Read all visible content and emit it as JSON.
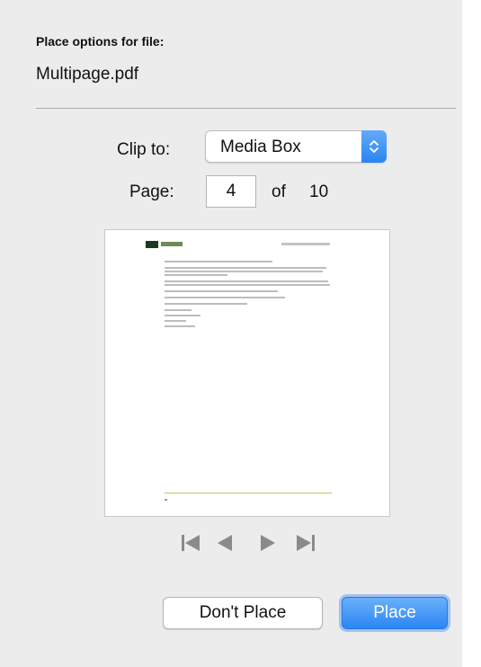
{
  "dialog": {
    "heading": "Place options for file:",
    "filename": "Multipage.pdf"
  },
  "clip": {
    "label": "Clip to:",
    "value": "Media Box"
  },
  "page": {
    "label": "Page:",
    "current": "4",
    "of_label": "of",
    "total": "10"
  },
  "navigation": {
    "first_icon": "first-page-icon",
    "prev_icon": "previous-page-icon",
    "next_icon": "next-page-icon",
    "last_icon": "last-page-icon"
  },
  "buttons": {
    "dont_place": "Don't Place",
    "place": "Place"
  },
  "colors": {
    "dialog_background": "#ececec",
    "accent_blue": "#2b86f5",
    "preview_footer_line": "#b7cf54",
    "preview_logo_dark": "#1e3a1e"
  }
}
